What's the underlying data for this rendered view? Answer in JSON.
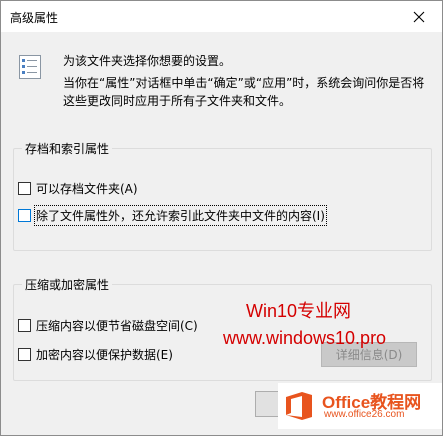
{
  "window": {
    "title": "高级属性"
  },
  "intro": "为该文件夹选择你想要的设置。",
  "description": "当你在“属性”对话框中单击“确定”或“应用”时，系统会询问你是否将这些更改同时应用于所有子文件夹和文件。",
  "archive_group": {
    "title": "存档和索引属性",
    "archive_label": "可以存档文件夹(A)",
    "index_label": "除了文件属性外，还允许索引此文件夹中文件的内容(I)"
  },
  "compress_group": {
    "title": "压缩或加密属性",
    "compress_label": "压缩内容以便节省磁盘空间(C)",
    "encrypt_label": "加密内容以便保护数据(E)",
    "details_label": "详细信息(D)"
  },
  "buttons": {
    "ok_label": ""
  },
  "watermark": {
    "line1": "Win10专业网",
    "line2": "www.windows10.pro",
    "logo_title": "Office教程网",
    "logo_url": "www.office26.com"
  },
  "checkboxes": {
    "archive": false,
    "index": false,
    "compress": false,
    "encrypt": false
  }
}
